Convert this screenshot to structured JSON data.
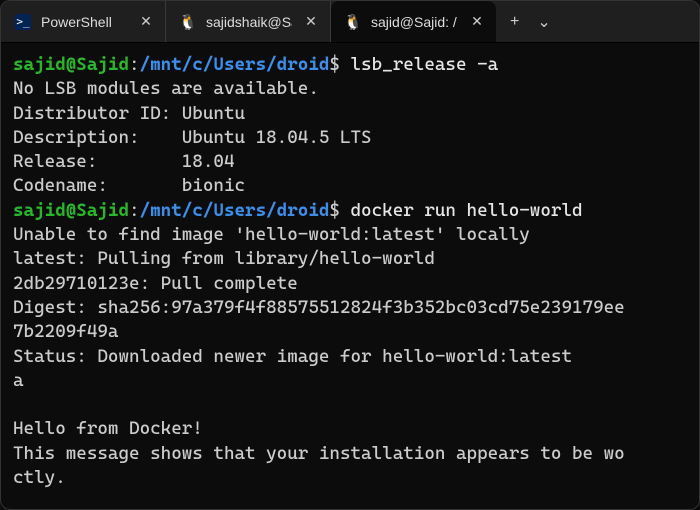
{
  "tabs": [
    {
      "icon": "powershell",
      "label": "PowerShell",
      "active": false
    },
    {
      "icon": "tux",
      "label": "sajidshaik@Sa",
      "active": false
    },
    {
      "icon": "tux",
      "label": "sajid@Sajid: /",
      "active": true
    }
  ],
  "tab_actions": {
    "new_tab": "+",
    "dropdown": "⌄"
  },
  "prompt": {
    "user_host": "sajid@Sajid",
    "sep": ":",
    "cwd": "/mnt/c/Users/droid",
    "symbol": "$"
  },
  "session": {
    "cmd1": "lsb_release -a",
    "out1_l1": "No LSB modules are available.",
    "out1_l2": "Distributor ID: Ubuntu",
    "out1_l3": "Description:    Ubuntu 18.04.5 LTS",
    "out1_l4": "Release:        18.04",
    "out1_l5": "Codename:       bionic",
    "cmd2": "docker run hello-world",
    "out2_l1": "Unable to find image 'hello-world:latest' locally",
    "out2_l2": "latest: Pulling from library/hello-world",
    "out2_l3": "2db29710123e: Pull complete",
    "out2_l4": "Digest: sha256:97a379f4f88575512824f3b352bc03cd75e239179ee",
    "out2_l5": "7b2209f49a",
    "out2_l6": "Status: Downloaded newer image for hello-world:latest",
    "out2_l7": "a",
    "out2_l8": "",
    "out2_l9": "Hello from Docker!",
    "out2_l10": "This message shows that your installation appears to be wo",
    "out2_l11": "ctly."
  }
}
